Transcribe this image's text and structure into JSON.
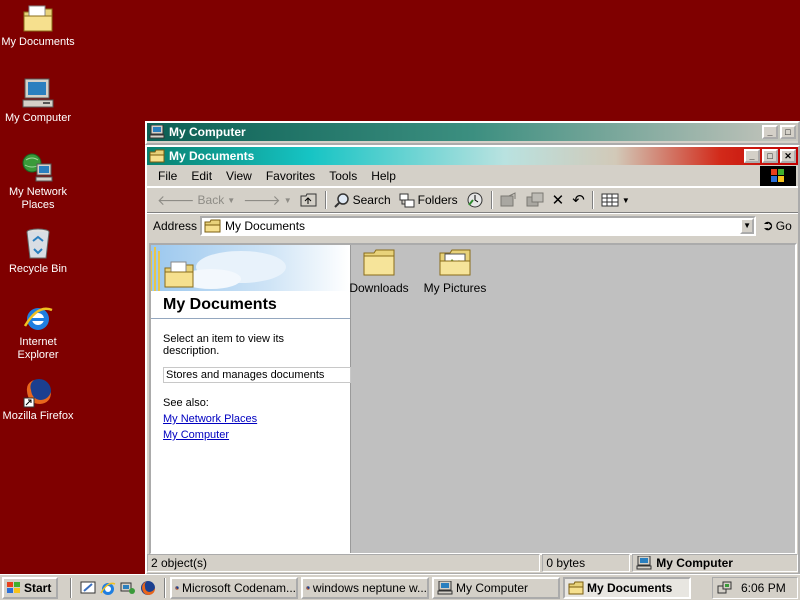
{
  "desktop": {
    "icons": [
      {
        "label": "My Documents",
        "icon": "folder-documents-icon"
      },
      {
        "label": "My Computer",
        "icon": "computer-icon"
      },
      {
        "label": "My Network Places",
        "icon": "network-icon"
      },
      {
        "label": "Recycle Bin",
        "icon": "recycle-bin-icon"
      },
      {
        "label": "Internet Explorer",
        "icon": "ie-icon"
      },
      {
        "label": "Mozilla Firefox",
        "icon": "firefox-icon"
      }
    ]
  },
  "back_window": {
    "title": "My Computer"
  },
  "window": {
    "title": "My Documents",
    "menu": [
      "File",
      "Edit",
      "View",
      "Favorites",
      "Tools",
      "Help"
    ],
    "toolbar": {
      "back": "Back",
      "search": "Search",
      "folders": "Folders"
    },
    "address": {
      "label": "Address",
      "value": "My Documents",
      "go": "Go"
    },
    "left_pane": {
      "title": "My Documents",
      "prompt": "Select an item to view its description.",
      "description": "Stores and manages documents",
      "see_also": "See also:",
      "links": [
        "My Network Places",
        "My Computer"
      ]
    },
    "items": [
      {
        "label": "Downloads",
        "icon": "folder-icon"
      },
      {
        "label": "My Pictures",
        "icon": "pictures-folder-icon"
      }
    ],
    "status": {
      "objects": "2 object(s)",
      "size": "0 bytes",
      "zone": "My Computer"
    }
  },
  "taskbar": {
    "start": "Start",
    "tasks": [
      {
        "label": "Microsoft Codenam...",
        "icon": "firefox-icon"
      },
      {
        "label": "windows neptune w...",
        "icon": "firefox-icon"
      },
      {
        "label": "My Computer",
        "icon": "computer-icon"
      },
      {
        "label": "My Documents",
        "icon": "folder-open-icon",
        "active": true
      }
    ],
    "clock": "6:06 PM"
  },
  "colors": {
    "desktop": "#7f0000",
    "window_face": "#d4d0c8",
    "link": "#0000c0"
  }
}
